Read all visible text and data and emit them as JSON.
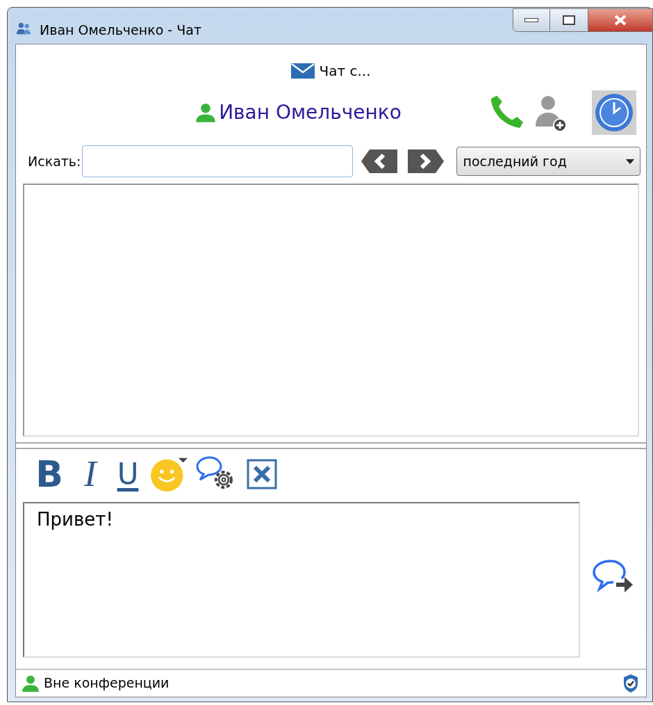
{
  "window": {
    "title": "Иван Омельченко - Чат"
  },
  "header": {
    "caption": "Чат с...",
    "contact_name": "Иван Омельченко"
  },
  "search": {
    "label": "Искать:"
  },
  "period_select": {
    "value": "последний год"
  },
  "format_toolbar": [
    {
      "kind": "bold",
      "label": "B"
    },
    {
      "kind": "italic",
      "label": "I"
    },
    {
      "kind": "underline",
      "label": "U"
    },
    {
      "kind": "emoji"
    },
    {
      "kind": "settings"
    },
    {
      "kind": "clear"
    }
  ],
  "message": {
    "value": "Привет!"
  },
  "status_bar": {
    "text": "Вне конференции"
  }
}
